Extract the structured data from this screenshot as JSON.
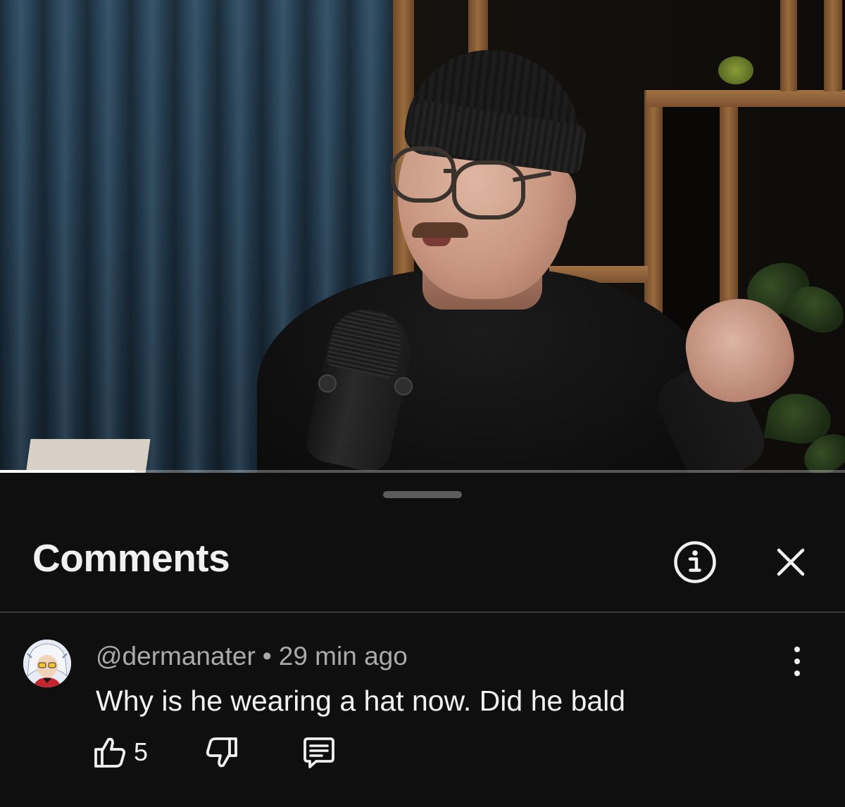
{
  "video": {
    "progress_fraction": 0.16
  },
  "comments_panel": {
    "title": "Comments",
    "info_icon": "info-circle-icon",
    "close_icon": "close-icon"
  },
  "comments": [
    {
      "author": "@dermanater",
      "separator": "•",
      "time": "29 min ago",
      "text": "Why is he wearing a hat now. Did he bald",
      "likes": "5",
      "icons": {
        "like": "thumbs-up-icon",
        "dislike": "thumbs-down-icon",
        "reply": "reply-comment-icon",
        "menu": "more-vertical-icon"
      }
    }
  ],
  "colors": {
    "background": "#0f0f0f",
    "text_primary": "#f1f1f1",
    "text_secondary": "#aaaaaa",
    "divider": "#3a3a3a"
  }
}
